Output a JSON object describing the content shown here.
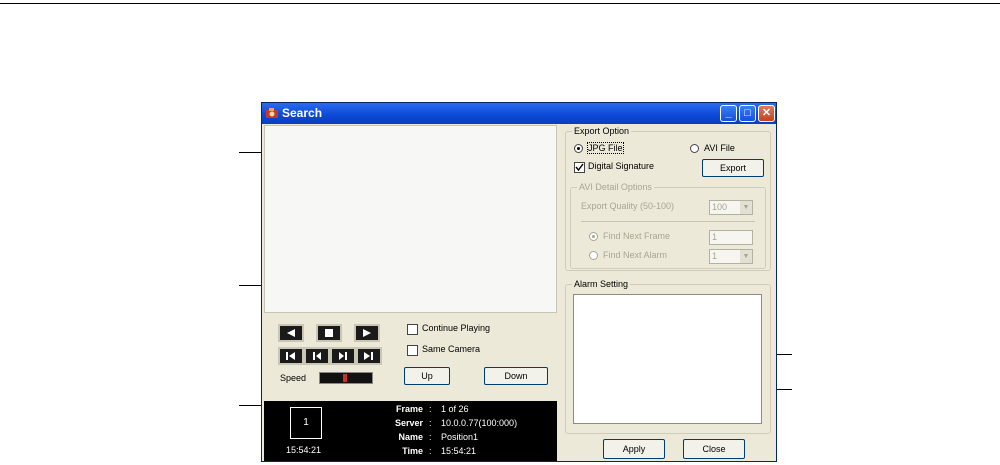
{
  "window": {
    "title": "Search"
  },
  "playback": {
    "speed_label": "Speed",
    "continue_playing_label": "Continue Playing",
    "continue_playing_checked": false,
    "same_camera_label": "Same Camera",
    "same_camera_checked": false,
    "up_label": "Up",
    "down_label": "Down"
  },
  "info": {
    "camera_number": "1",
    "clock": "15:54:21",
    "frame_label": "Frame",
    "frame_value": "1 of 26",
    "server_label": "Server",
    "server_value": "10.0.0.77(100:000)",
    "name_label": "Name",
    "name_value": "Position1",
    "time_label": "Time",
    "time_value": "15:54:21",
    "separator": ":"
  },
  "export": {
    "group_title": "Export Option",
    "jpg_label": "JPG File",
    "avi_label": "AVI File",
    "selected_format": "JPG File",
    "digital_signature_label": "Digital Signature",
    "digital_signature_checked": true,
    "export_button": "Export",
    "avi_detail": {
      "group_title": "AVI Detail Options",
      "quality_label": "Export Quality (50-100)",
      "quality_value": "100",
      "find_next_frame_label": "Find Next Frame",
      "find_next_frame_value": "1",
      "find_next_alarm_label": "Find Next Alarm",
      "find_next_alarm_value": "1"
    }
  },
  "alarm": {
    "group_title": "Alarm Setting"
  },
  "footer": {
    "apply_label": "Apply",
    "close_label": "Close"
  },
  "icons": {
    "app": "camera-icon",
    "minimize": "minimize-icon",
    "maximize": "maximize-icon",
    "close": "close-icon"
  }
}
